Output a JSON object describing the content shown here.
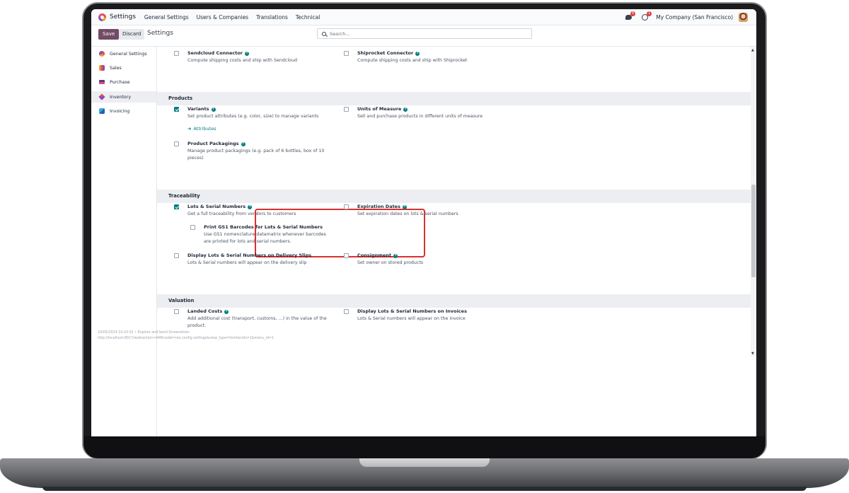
{
  "navbar": {
    "app_name": "Settings",
    "menus": [
      "General Settings",
      "Users & Companies",
      "Translations",
      "Technical"
    ],
    "chat_badge": "6",
    "activity_badge": "1",
    "company": "My Company (San Francisco)"
  },
  "control_panel": {
    "save_label": "Save",
    "discard_label": "Discard",
    "title": "Settings",
    "search_placeholder": "Search..."
  },
  "sidebar": {
    "items": [
      {
        "label": "General Settings",
        "icon": "general-settings-icon"
      },
      {
        "label": "Sales",
        "icon": "sales-icon"
      },
      {
        "label": "Purchase",
        "icon": "purchase-icon"
      },
      {
        "label": "Inventory",
        "icon": "inventory-icon",
        "active": true
      },
      {
        "label": "Invoicing",
        "icon": "invoicing-icon"
      }
    ]
  },
  "shipping": {
    "sendcloud": {
      "title": "Sendcloud Connector",
      "desc": "Compute shipping costs and ship with Sendcloud",
      "checked": false
    },
    "shiprocket": {
      "title": "Shiprocket Connector",
      "desc": "Compute shipping costs and ship with Shiprocket",
      "checked": false
    }
  },
  "products": {
    "heading": "Products",
    "variants": {
      "title": "Variants",
      "desc": "Set product attributes (e.g. color, size) to manage variants",
      "link": "Attributes",
      "checked": true
    },
    "uom": {
      "title": "Units of Measure",
      "desc": "Sell and purchase products in different units of measure",
      "checked": false
    },
    "packagings": {
      "title": "Product Packagings",
      "desc": "Manage product packagings (e.g. pack of 6 bottles, box of 10 pieces)",
      "checked": false
    }
  },
  "traceability": {
    "heading": "Traceability",
    "lots": {
      "title": "Lots & Serial Numbers",
      "desc": "Get a full traceability from vendors to customers",
      "checked": true
    },
    "gs1": {
      "title": "Print GS1 Barcodes for Lots & Serial Numbers",
      "desc": "Use GS1 nomenclature datamatrix whenever barcodes are printed for lots and serial numbers.",
      "checked": false
    },
    "expiration": {
      "title": "Expiration Dates",
      "desc": "Set expiration dates on lots & serial numbers",
      "checked": false
    },
    "delivery_slips": {
      "title": "Display Lots & Serial Numbers on Delivery Slips",
      "desc": "Lots & Serial numbers will appear on the delivery slip",
      "checked": false
    },
    "consignment": {
      "title": "Consignment",
      "desc": "Set owner on stored products",
      "checked": false
    }
  },
  "valuation": {
    "heading": "Valuation",
    "landed_costs": {
      "title": "Landed Costs",
      "desc": "Add additional cost (transport, customs, ...) in the value of the product.",
      "checked": false
    },
    "invoices": {
      "title": "Display Lots & Serial Numbers on Invoices",
      "desc": "Lots & Serial numbers will appear on the invoice",
      "checked": false
    }
  },
  "watermark": {
    "line1": "10/05/2024 10:20:32 • Explore and Send Screenshots",
    "line2": "http://localhost:8017/web/action=448model=res.config.settings&view_type=form&cids=1&menu_id=1"
  },
  "colors": {
    "primary": "#714b67",
    "teal": "#017e84",
    "highlight": "#d9302f"
  }
}
